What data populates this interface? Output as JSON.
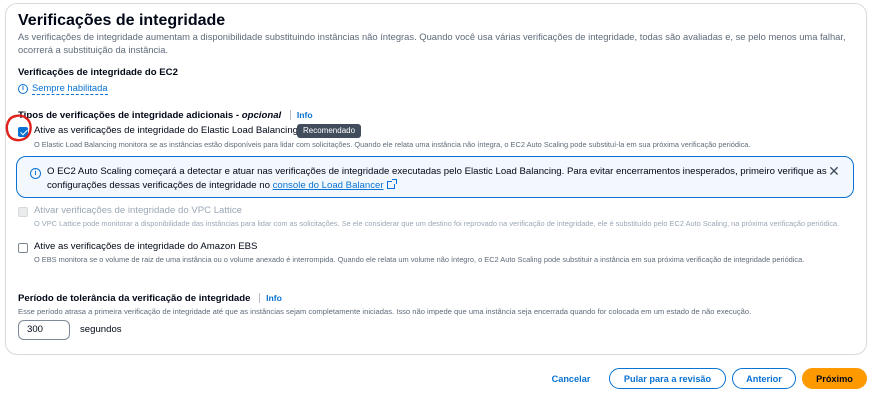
{
  "panel": {
    "title": "Verificações de integridade",
    "description": "As verificações de integridade aumentam a disponibilidade substituindo instâncias não íntegras. Quando você usa várias verificações de integridade, todas são avaliadas e, se pelo menos uma falhar, ocorrerá a substituição da instância."
  },
  "ec2_section": {
    "label": "Verificações de integridade do EC2",
    "status": "Sempre habilitada"
  },
  "additional_section": {
    "label": "Tipos de verificações de integridade adicionais - ",
    "optional": "opcional",
    "info": "Info"
  },
  "options": {
    "elb": {
      "checked": true,
      "label": "Ative as verificações de integridade do Elastic Load Balancing",
      "badge": "Recomendado",
      "description": "O Elastic Load Balancing monitora se as instâncias estão disponíveis para lidar com solicitações. Quando ele relata uma instância não íntegra, o EC2 Auto Scaling pode substituí-la em sua próxima verificação periódica."
    },
    "vpc_lattice": {
      "checked": false,
      "disabled": true,
      "label": "Ativar verificações de integridade do VPC Lattice",
      "description": "O VPC Lattice pode monitorar a disponibilidade das instâncias para lidar com as solicitações. Se ele considerar que um destino foi reprovado na verificação de integridade, ele é substituído pelo EC2 Auto Scaling, na próxima verificação periódica."
    },
    "ebs": {
      "checked": false,
      "label": "Ative as verificações de integridade do Amazon EBS",
      "description": "O EBS monitora se o volume de raiz de uma instância ou o volume anexado é interrompida. Quando ele relata um volume não íntegro, o EC2 Auto Scaling pode substituir a instância em sua próxima verificação de integridade periódica."
    }
  },
  "alert": {
    "text": "O EC2 Auto Scaling começará a detectar e atuar nas verificações de integridade executadas pelo Elastic Load Balancing. Para evitar encerramentos inesperados, primeiro verifique as configurações dessas verificações de integridade no ",
    "link": "console do Load Balancer"
  },
  "grace": {
    "label": "Período de tolerância da verificação de integridade",
    "info": "Info",
    "description": "Esse período atrasa a primeira verificação de integridade até que as instâncias sejam completamente iniciadas. Isso não impede que uma instância seja encerrada quando for colocada em um estado de não execução.",
    "value": "300",
    "unit": "segundos"
  },
  "footer": {
    "cancel": "Cancelar",
    "skip": "Pular para a revisão",
    "previous": "Anterior",
    "next": "Próximo"
  },
  "colors": {
    "link": "#0972d3",
    "primary": "#ff9900",
    "annotation": "#e0201b"
  }
}
